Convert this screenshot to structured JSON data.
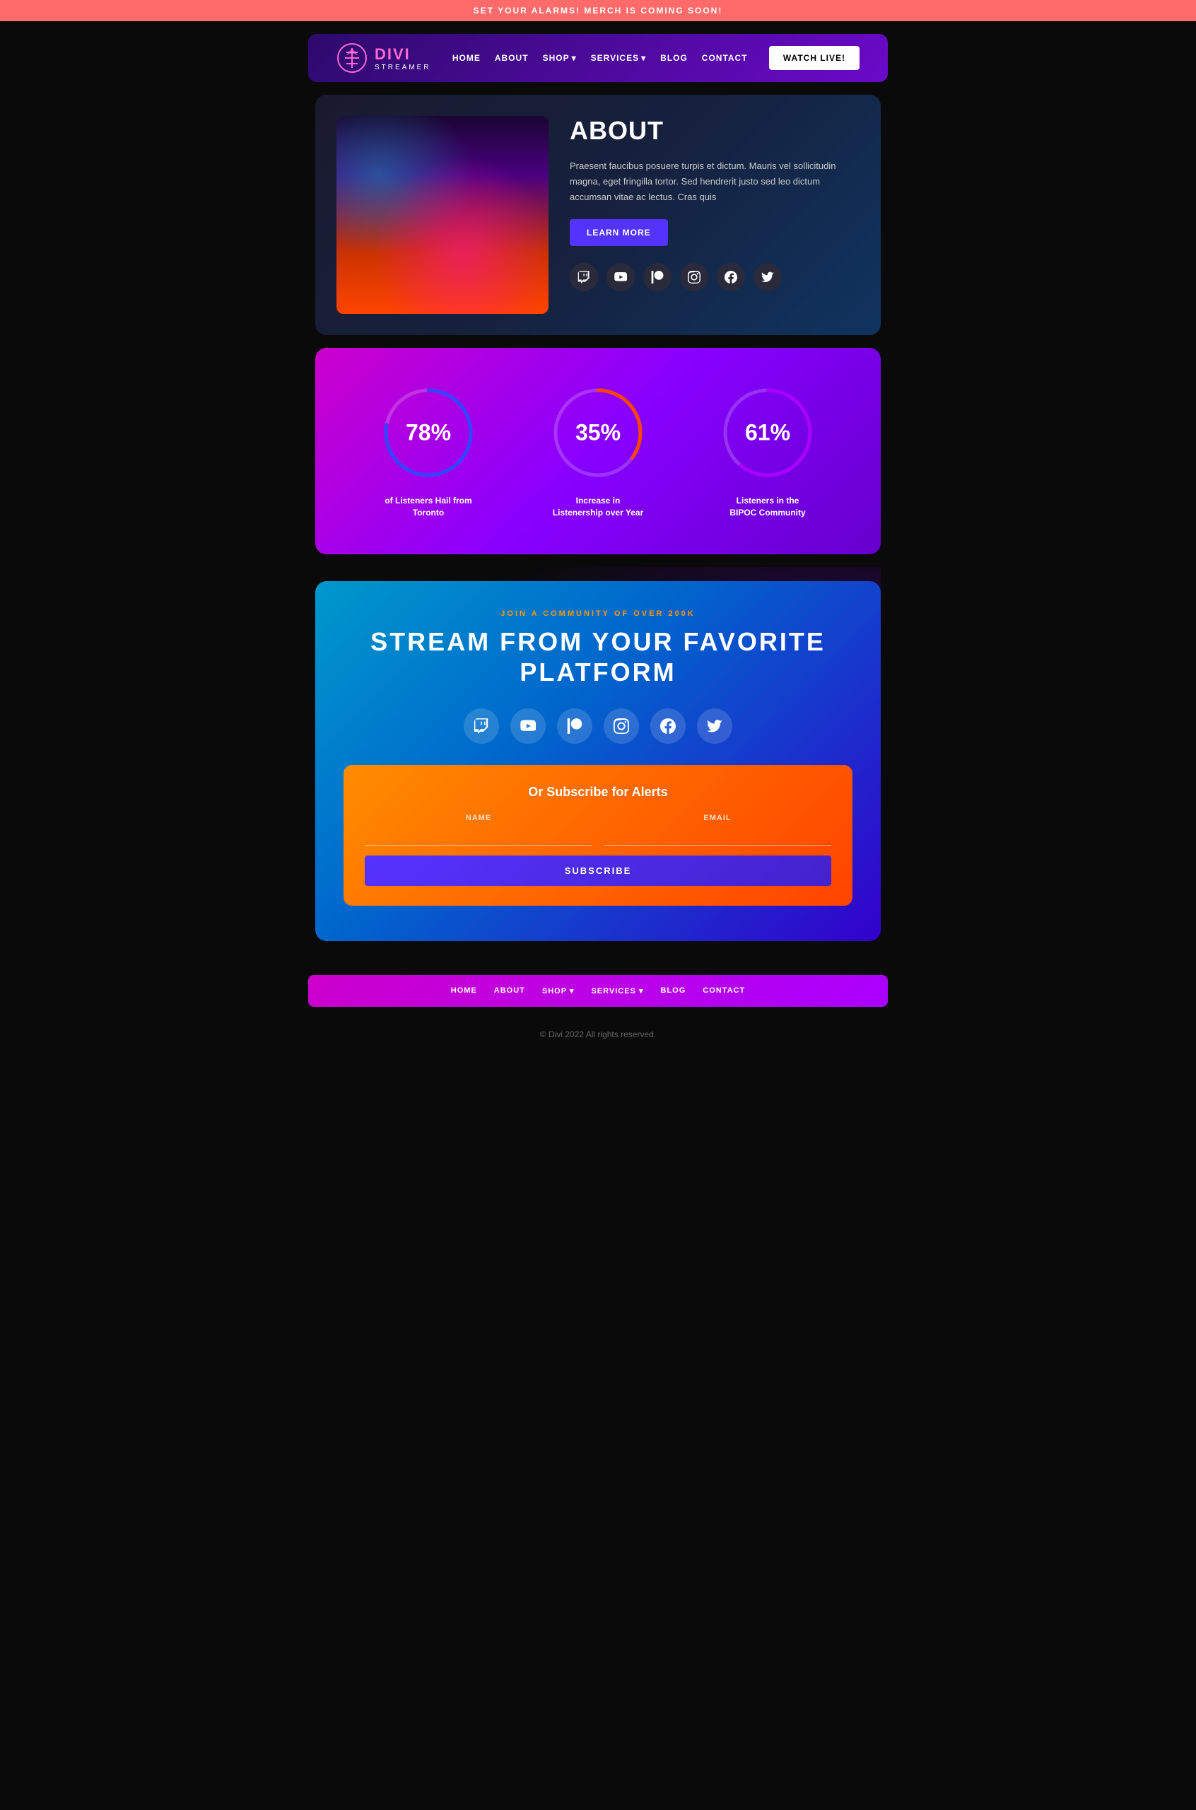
{
  "topBanner": {
    "text": "SET YOUR ALARMS! MERCH IS COMING SOON!"
  },
  "header": {
    "logo": {
      "divi": "DIVI",
      "streamer": "STREAMER"
    },
    "nav": [
      {
        "label": "HOME",
        "hasDropdown": false
      },
      {
        "label": "ABOUT",
        "hasDropdown": false
      },
      {
        "label": "SHOP",
        "hasDropdown": true
      },
      {
        "label": "SERVICES",
        "hasDropdown": true
      },
      {
        "label": "BLOG",
        "hasDropdown": false
      },
      {
        "label": "CONTACT",
        "hasDropdown": false
      }
    ],
    "watchButton": "WATCH LIVE!"
  },
  "about": {
    "title": "ABOUT",
    "text": "Praesent faucibus posuere turpis et dictum. Mauris vel sollicitudin magna, eget fringilla tortor. Sed hendrerit justo sed leo dictum accumsan vitae ac lectus. Cras quis",
    "learnMore": "LEARN MORE",
    "socialIcons": [
      {
        "name": "twitch-icon",
        "symbol": "📺"
      },
      {
        "name": "youtube-icon",
        "symbol": "▶"
      },
      {
        "name": "patreon-icon",
        "symbol": "⚑"
      },
      {
        "name": "instagram-icon",
        "symbol": "📷"
      },
      {
        "name": "facebook-icon",
        "symbol": "f"
      },
      {
        "name": "twitter-icon",
        "symbol": "🐦"
      }
    ]
  },
  "stats": [
    {
      "value": "78%",
      "label": "of Listeners Hail from Toronto",
      "percent": 78,
      "color1": "#0044ff",
      "color2": "#cc00ff"
    },
    {
      "value": "35%",
      "label": "Increase in Listenership over Year",
      "percent": 35,
      "color1": "#ff4400",
      "color2": "#ff00aa"
    },
    {
      "value": "61%",
      "label": "Listeners in the BIPOC Community",
      "percent": 61,
      "color1": "#8800ff",
      "color2": "#cc00ff"
    }
  ],
  "stream": {
    "subtitle": "JOIN A COMMUNITY OF OVER 200K",
    "title": "STREAM FROM YOUR FAVORITE PLATFORM",
    "socialIcons": [
      {
        "name": "twitch-icon",
        "symbol": "📺"
      },
      {
        "name": "youtube-icon",
        "symbol": "▶"
      },
      {
        "name": "patreon-icon",
        "symbol": "⚑"
      },
      {
        "name": "instagram-icon",
        "symbol": "📷"
      },
      {
        "name": "facebook-icon",
        "symbol": "f"
      },
      {
        "name": "twitter-icon",
        "symbol": "🐦"
      }
    ]
  },
  "subscribe": {
    "title": "Or Subscribe for Alerts",
    "namePlaceholder": "",
    "emailPlaceholder": "",
    "nameLabel": "NAME",
    "emailLabel": "EMAIL",
    "button": "SUBSCRIBE"
  },
  "footerNav": [
    {
      "label": "HOME",
      "hasDropdown": false
    },
    {
      "label": "ABOUT",
      "hasDropdown": false
    },
    {
      "label": "SHOP",
      "hasDropdown": true
    },
    {
      "label": "SERVICES",
      "hasDropdown": true
    },
    {
      "label": "BLOG",
      "hasDropdown": false
    },
    {
      "label": "CONTACT",
      "hasDropdown": false
    }
  ],
  "copyright": "© Divi 2022 All rights reserved."
}
